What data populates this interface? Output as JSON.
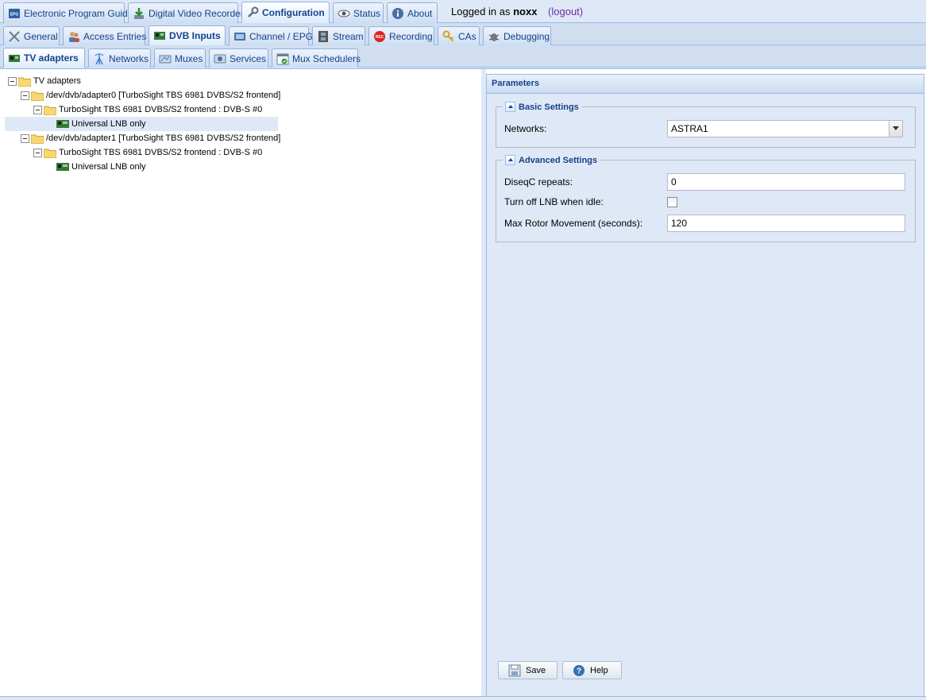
{
  "top_tabs": [
    {
      "label": "Electronic Program Guide",
      "icon": "epg-icon"
    },
    {
      "label": "Digital Video Recorder",
      "icon": "download-icon"
    },
    {
      "label": "Configuration",
      "icon": "wrench-icon",
      "active": true
    },
    {
      "label": "Status",
      "icon": "eye-icon"
    },
    {
      "label": "About",
      "icon": "info-icon"
    }
  ],
  "login": {
    "prefix": "Logged in as",
    "user": "noxx",
    "logout": "(logout)"
  },
  "config_tabs": [
    {
      "label": "General",
      "icon": "tools-icon"
    },
    {
      "label": "Access Entries",
      "icon": "users-icon"
    },
    {
      "label": "DVB Inputs",
      "icon": "dvb-card-icon",
      "active": true
    },
    {
      "label": "Channel / EPG",
      "icon": "tv-icon"
    },
    {
      "label": "Stream",
      "icon": "film-icon"
    },
    {
      "label": "Recording",
      "icon": "rec-icon"
    },
    {
      "label": "CAs",
      "icon": "key-icon"
    },
    {
      "label": "Debugging",
      "icon": "bug-icon"
    }
  ],
  "dvb_tabs": [
    {
      "label": "TV adapters",
      "icon": "card-icon",
      "active": true
    },
    {
      "label": "Networks",
      "icon": "antenna-icon"
    },
    {
      "label": "Muxes",
      "icon": "mux-icon"
    },
    {
      "label": "Services",
      "icon": "services-icon"
    },
    {
      "label": "Mux Schedulers",
      "icon": "calendar-icon"
    }
  ],
  "tree": [
    {
      "label": "TV adapters",
      "level": 0,
      "type": "folder"
    },
    {
      "label": "/dev/dvb/adapter0 [TurboSight TBS 6981 DVBS/S2 frontend]",
      "level": 1,
      "type": "folder"
    },
    {
      "label": "TurboSight TBS 6981 DVBS/S2 frontend : DVB-S #0",
      "level": 2,
      "type": "folder"
    },
    {
      "label": "Universal LNB only",
      "level": 3,
      "type": "leaf",
      "selected": true
    },
    {
      "label": "/dev/dvb/adapter1 [TurboSight TBS 6981 DVBS/S2 frontend]",
      "level": 1,
      "type": "folder"
    },
    {
      "label": "TurboSight TBS 6981 DVBS/S2 frontend : DVB-S #0",
      "level": 2,
      "type": "folder"
    },
    {
      "label": "Universal LNB only",
      "level": 3,
      "type": "leaf"
    }
  ],
  "params": {
    "title": "Parameters",
    "basic": {
      "legend": "Basic Settings",
      "networks_label": "Networks:",
      "networks_value": "ASTRA1"
    },
    "advanced": {
      "legend": "Advanced Settings",
      "diseqc_label": "DiseqC repeats:",
      "diseqc_value": "0",
      "lnb_off_label": "Turn off LNB when idle:",
      "lnb_off_checked": false,
      "rotor_label": "Max Rotor Movement (seconds):",
      "rotor_value": "120"
    },
    "save_label": "Save",
    "help_label": "Help"
  }
}
